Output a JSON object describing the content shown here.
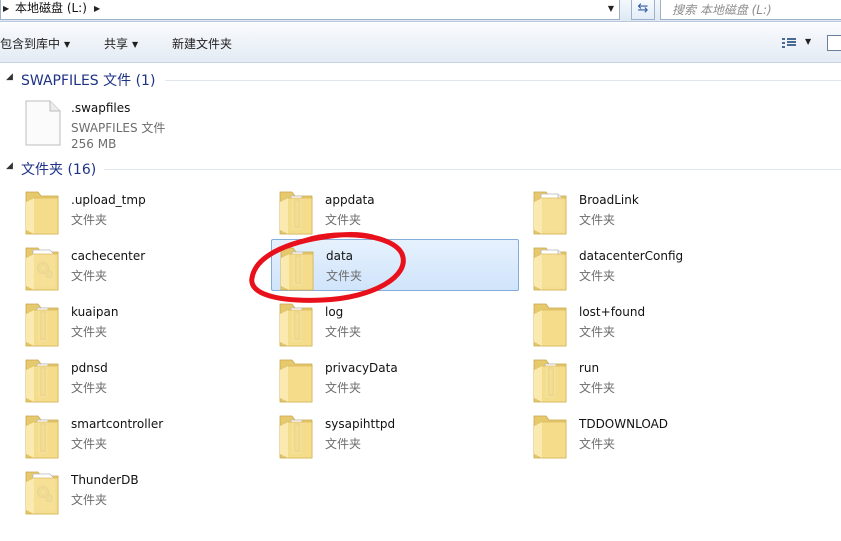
{
  "address": {
    "breadcrumb": "本地磁盘 (L:)",
    "search_placeholder": "搜索 本地磁盘 (L:)"
  },
  "toolbar": {
    "include_library": "包含到库中",
    "share": "共享",
    "new_folder": "新建文件夹"
  },
  "groups": [
    {
      "title": "SWAPFILES 文件 (1)",
      "items": [
        {
          "name": ".swapfiles",
          "type": "SWAPFILES 文件",
          "size": "256 MB",
          "icon": "file-icon"
        }
      ]
    },
    {
      "title": "文件夹 (16)",
      "items": [
        {
          "name": ".upload_tmp",
          "type": "文件夹",
          "icon": "folder-empty-icon"
        },
        {
          "name": "appdata",
          "type": "文件夹",
          "icon": "folder-files-icon"
        },
        {
          "name": "BroadLink",
          "type": "文件夹",
          "icon": "folder-doc-icon"
        },
        {
          "name": "cachecenter",
          "type": "文件夹",
          "icon": "folder-settings-icon"
        },
        {
          "name": "data",
          "type": "文件夹",
          "icon": "folder-files-icon",
          "selected": true
        },
        {
          "name": "datacenterConfig",
          "type": "文件夹",
          "icon": "folder-doc-icon"
        },
        {
          "name": "kuaipan",
          "type": "文件夹",
          "icon": "folder-files-icon"
        },
        {
          "name": "log",
          "type": "文件夹",
          "icon": "folder-files-icon"
        },
        {
          "name": "lost+found",
          "type": "文件夹",
          "icon": "folder-empty-icon"
        },
        {
          "name": "pdnsd",
          "type": "文件夹",
          "icon": "folder-files-icon"
        },
        {
          "name": "privacyData",
          "type": "文件夹",
          "icon": "folder-empty-icon"
        },
        {
          "name": "run",
          "type": "文件夹",
          "icon": "folder-files-icon"
        },
        {
          "name": "smartcontroller",
          "type": "文件夹",
          "icon": "folder-files-icon"
        },
        {
          "name": "sysapihttpd",
          "type": "文件夹",
          "icon": "folder-files-icon"
        },
        {
          "name": "TDDOWNLOAD",
          "type": "文件夹",
          "icon": "folder-empty-icon"
        },
        {
          "name": "ThunderDB",
          "type": "文件夹",
          "icon": "folder-settings-icon"
        }
      ]
    }
  ],
  "colors": {
    "group_title": "#1e3287",
    "selection_fill": "#d0e4fb",
    "selection_border": "#84acdd",
    "annotation": "#e8101a"
  }
}
